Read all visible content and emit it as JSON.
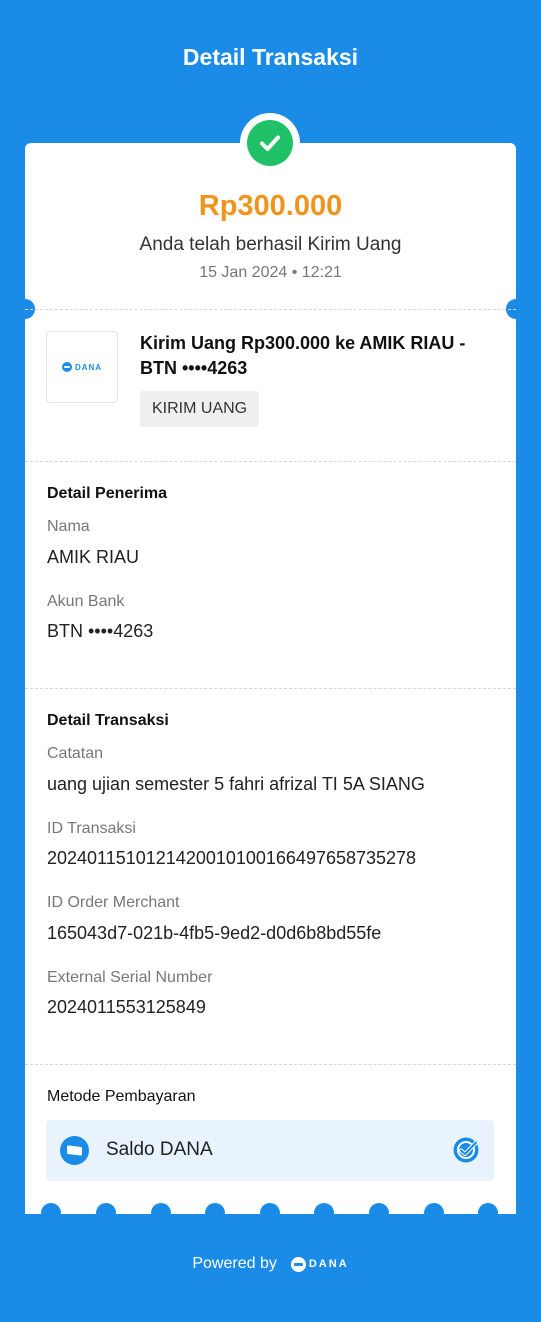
{
  "header": {
    "title": "Detail Transaksi"
  },
  "summary": {
    "amount": "Rp300.000",
    "status": "Anda telah berhasil Kirim Uang",
    "datetime": "15 Jan 2024 • 12:21"
  },
  "transaction": {
    "logo_text": "DANA",
    "title": "Kirim Uang Rp300.000 ke AMIK RIAU - BTN ••••4263",
    "type_chip": "KIRIM UANG"
  },
  "recipient": {
    "section_title": "Detail Penerima",
    "fields": [
      {
        "label": "Nama",
        "value": "AMIK RIAU"
      },
      {
        "label": "Akun Bank",
        "value": "BTN ••••4263"
      }
    ]
  },
  "details": {
    "section_title": "Detail Transaksi",
    "fields": [
      {
        "label": "Catatan",
        "value": "uang ujian semester 5 fahri afrizal TI 5A SIANG"
      },
      {
        "label": "ID Transaksi",
        "value": "2024011510121420010100166497658735278"
      },
      {
        "label": "ID Order Merchant",
        "value": "165043d7-021b-4fb5-9ed2-d0d6b8bd55fe"
      },
      {
        "label": "External Serial Number",
        "value": "2024011553125849"
      }
    ]
  },
  "payment": {
    "section_title": "Metode Pembayaran",
    "method": "Saldo DANA",
    "selected": true
  },
  "footer": {
    "powered_by": "Powered by",
    "brand": "DANA"
  },
  "colors": {
    "primary": "#1a8ce8",
    "amount": "#f0941b",
    "success": "#20c166"
  },
  "icons": [
    "check-circle-icon",
    "dana-logo-icon",
    "wallet-icon",
    "selected-check-icon"
  ]
}
